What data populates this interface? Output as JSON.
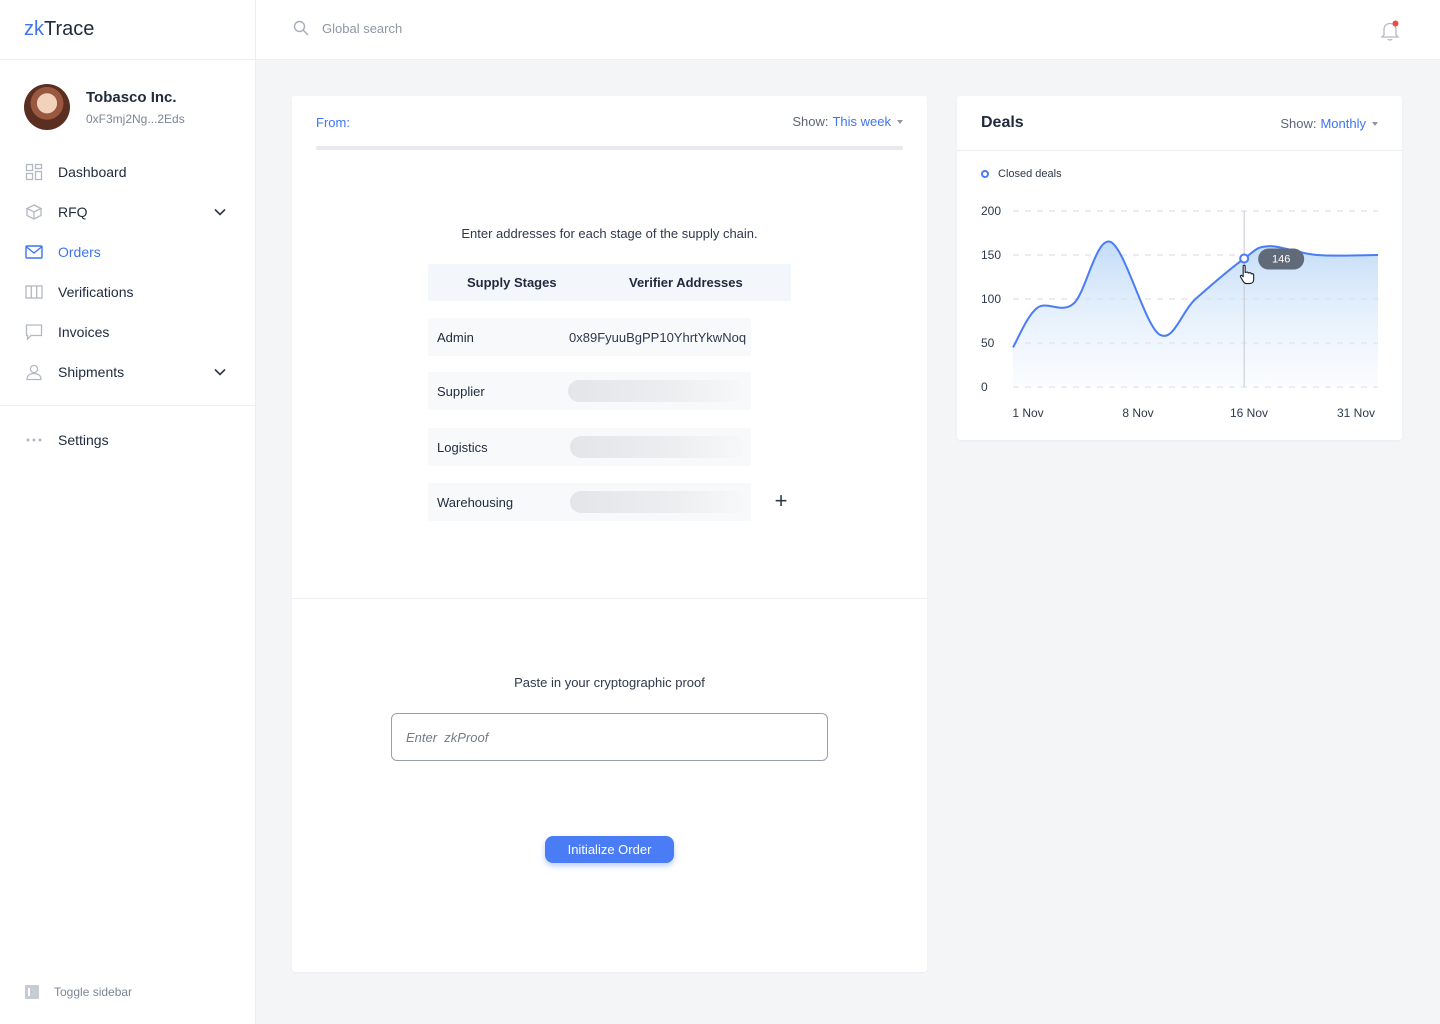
{
  "app": {
    "logo_prefix": "zk",
    "logo_suffix": "Trace"
  },
  "profile": {
    "name": "Tobasco Inc.",
    "address": "0xF3mj2Ng...2Eds"
  },
  "sidebar": {
    "items": [
      {
        "label": "Dashboard",
        "icon": "dashboard-icon"
      },
      {
        "label": "RFQ",
        "icon": "rfq-icon",
        "expandable": true
      },
      {
        "label": "Orders",
        "icon": "mail-icon",
        "active": true
      },
      {
        "label": "Verifications",
        "icon": "columns-icon"
      },
      {
        "label": "Invoices",
        "icon": "chat-icon"
      },
      {
        "label": "Shipments",
        "icon": "user-icon",
        "expandable": true
      }
    ],
    "settings_label": "Settings",
    "toggle_label": "Toggle sidebar"
  },
  "search": {
    "placeholder": "Global search"
  },
  "notifications": {
    "has_unread": true
  },
  "order_card": {
    "from_label": "From:",
    "show_label": "Show:",
    "show_value": "This week",
    "instruction": "Enter addresses for each stage of the supply chain.",
    "columns": [
      "Supply Stages",
      "Verifier Addresses"
    ],
    "stages": [
      {
        "name": "Admin",
        "address": "0x89FyuuBgPP10YhrtYkwNoq"
      },
      {
        "name": "Supplier",
        "address": ""
      },
      {
        "name": "Logistics",
        "address": ""
      },
      {
        "name": "Warehousing",
        "address": ""
      }
    ],
    "add_stage_symbol": "+",
    "proof_label": "Paste in your cryptographic proof",
    "proof_placeholder": "Enter  zkProof",
    "submit_label": "Initialize Order"
  },
  "deals": {
    "title": "Deals",
    "show_label": "Show:",
    "show_value": "Monthly",
    "legend": "Closed deals",
    "accent": "#4a7cf5"
  },
  "chart_data": {
    "type": "area",
    "title": "Deals",
    "series": [
      {
        "name": "Closed deals",
        "x": [
          1,
          3,
          6,
          9,
          13,
          16,
          20,
          22,
          26,
          31
        ],
        "y": [
          45,
          90,
          95,
          165,
          60,
          100,
          146,
          160,
          150,
          150
        ]
      }
    ],
    "xticks": [
      "1 Nov",
      "8 Nov",
      "16 Nov",
      "31 Nov"
    ],
    "yticks": [
      "0",
      "50",
      "100",
      "150",
      "200"
    ],
    "ylim": [
      0,
      200
    ],
    "xlim": [
      1,
      31
    ],
    "grid": true,
    "tooltip": {
      "x": 20,
      "label": "146"
    }
  }
}
